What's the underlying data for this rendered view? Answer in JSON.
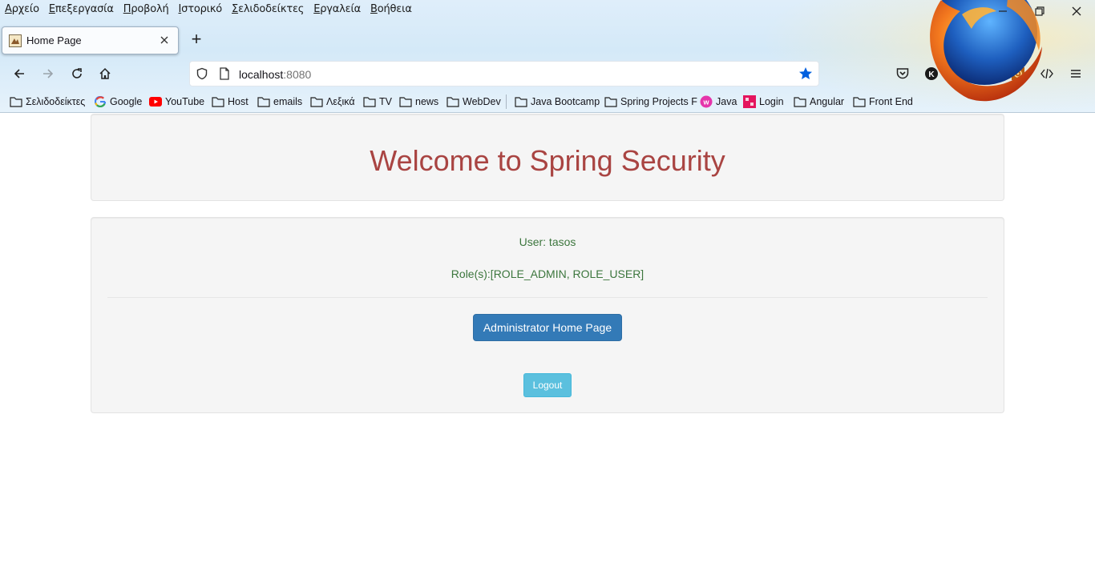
{
  "menubar": {
    "items": [
      {
        "first": "Α",
        "rest": "ρχείο"
      },
      {
        "first": "Ε",
        "rest": "πεξεργασία"
      },
      {
        "first": "Π",
        "rest": "ροβολή"
      },
      {
        "first": "Ι",
        "rest": "στορικό"
      },
      {
        "first": "Σ",
        "rest": "ελιδοδείκτες"
      },
      {
        "first": "Ε",
        "rest": "ργαλεία"
      },
      {
        "first": "Β",
        "rest": "οήθεια"
      }
    ]
  },
  "window_controls": {
    "minimize": "—",
    "restore": "❐",
    "close": "✕"
  },
  "tab": {
    "title": "Home Page",
    "close": "✕"
  },
  "new_tab": "+",
  "urlbar": {
    "host": "localhost",
    "port": ":8080"
  },
  "bookmarks": [
    {
      "label": "Σελιδοδείκτες",
      "icon": "folder-icon"
    },
    {
      "label": "Google",
      "icon": "google-icon"
    },
    {
      "label": "YouTube",
      "icon": "youtube-icon"
    },
    {
      "label": "Host",
      "icon": "folder-icon"
    },
    {
      "label": "emails",
      "icon": "folder-icon"
    },
    {
      "label": "Λεξικά",
      "icon": "folder-icon"
    },
    {
      "label": "TV",
      "icon": "folder-icon"
    },
    {
      "label": "news",
      "icon": "folder-icon"
    },
    {
      "label": "WebDev",
      "icon": "folder-icon"
    },
    {
      "label": "Java Bootcamp",
      "icon": "folder-icon"
    },
    {
      "label": "Spring Projects F",
      "icon": "folder-icon"
    },
    {
      "label": "Java",
      "icon": "java-site-icon"
    },
    {
      "label": "Login",
      "icon": "login-site-icon"
    },
    {
      "label": "Angular",
      "icon": "folder-icon"
    },
    {
      "label": "Front End",
      "icon": "folder-icon"
    }
  ],
  "toolbar_icons": [
    "pocket-icon",
    "extension-k-icon",
    "highlighter-icon",
    "yd-extension-icon",
    "gear-extension-icon",
    "devtools-icon",
    "menu-icon"
  ],
  "extension_labels": {
    "k": "K",
    "yd": "yD"
  },
  "page": {
    "welcome": "Welcome to Spring Security",
    "user": "User: tasos",
    "roles": "Role(s):[ROLE_ADMIN, ROLE_USER]",
    "admin_button": "Administrator Home Page",
    "logout_button": "Logout"
  },
  "colors": {
    "welcome_text": "#a94442",
    "success_text": "#3c763d",
    "primary_button": "#337ab7",
    "info_button": "#5bc0de",
    "well_bg": "#f5f5f5"
  }
}
